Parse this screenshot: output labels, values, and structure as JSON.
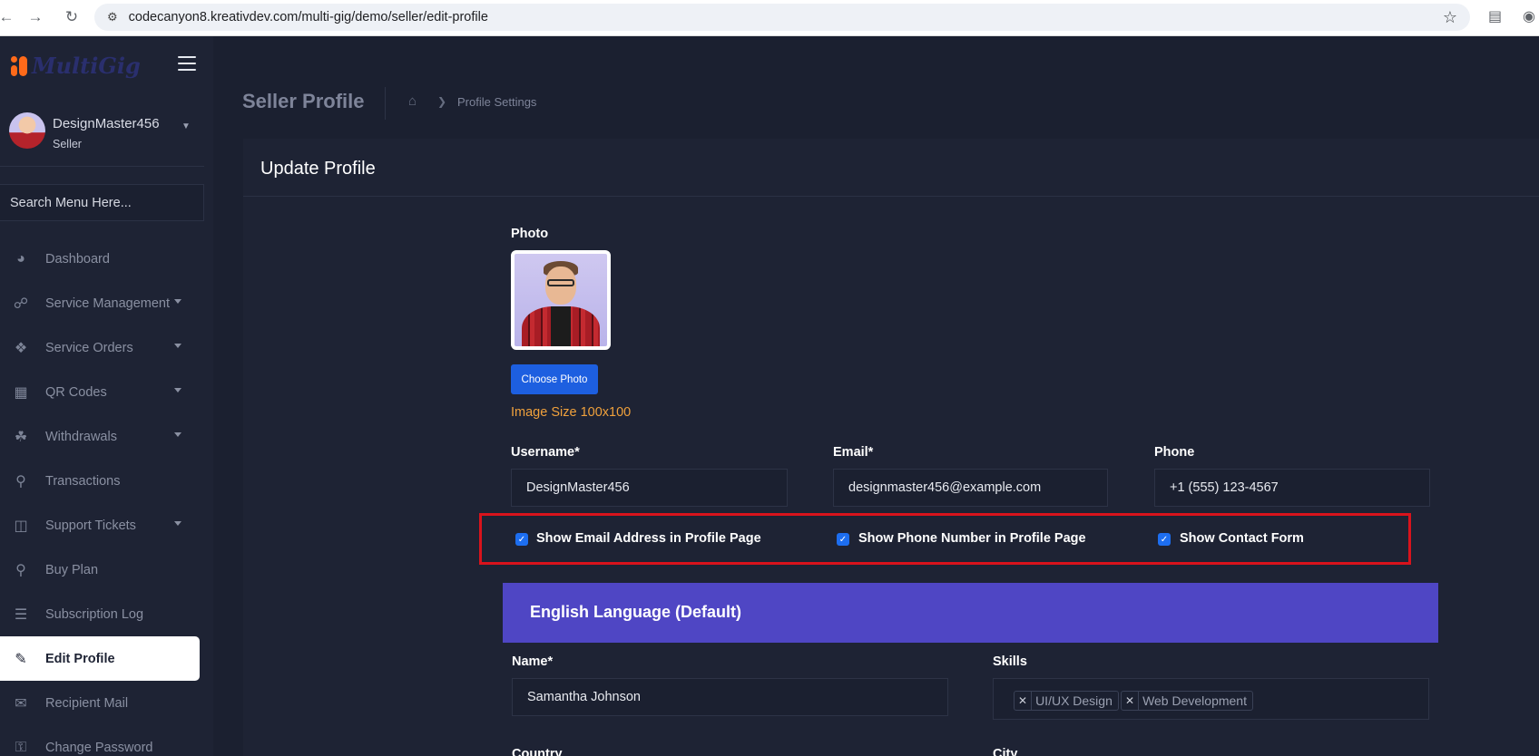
{
  "browser": {
    "url": "codecanyon8.kreativdev.com/multi-gig/demo/seller/edit-profile"
  },
  "brand": {
    "logo_text": "MultiGig",
    "accent": "#ff6a1a"
  },
  "user": {
    "name": "DesignMaster456",
    "role": "Seller"
  },
  "sidebar": {
    "search_placeholder": "Search Menu Here...",
    "items": [
      {
        "label": "Dashboard",
        "icon": "gauge-icon",
        "caret": false
      },
      {
        "label": "Service Management",
        "icon": "headset-icon",
        "caret": true
      },
      {
        "label": "Service Orders",
        "icon": "boxes-icon",
        "caret": true
      },
      {
        "label": "QR Codes",
        "icon": "qr-code-icon",
        "caret": true
      },
      {
        "label": "Withdrawals",
        "icon": "money-bag-icon",
        "caret": true
      },
      {
        "label": "Transactions",
        "icon": "lightbulb-icon",
        "caret": false
      },
      {
        "label": "Support Tickets",
        "icon": "ticket-icon",
        "caret": true
      },
      {
        "label": "Buy Plan",
        "icon": "bulb-icon",
        "caret": false
      },
      {
        "label": "Subscription Log",
        "icon": "list-icon",
        "caret": false
      },
      {
        "label": "Edit Profile",
        "icon": "user-edit-icon",
        "caret": false,
        "active": true
      },
      {
        "label": "Recipient Mail",
        "icon": "envelope-icon",
        "caret": false
      },
      {
        "label": "Change Password",
        "icon": "key-icon",
        "caret": false
      }
    ]
  },
  "header": {
    "page_title": "Seller Profile",
    "breadcrumb_current": "Profile Settings"
  },
  "card": {
    "title": "Update Profile",
    "photo_label": "Photo",
    "choose_photo": "Choose Photo",
    "image_size_note": "Image Size 100x100",
    "username_label": "Username*",
    "username_value": "DesignMaster456",
    "email_label": "Email*",
    "email_value": "designmaster456@example.com",
    "phone_label": "Phone",
    "phone_value": "+1 (555) 123-4567",
    "checkboxes": [
      {
        "label": "Show Email Address in Profile Page",
        "checked": true
      },
      {
        "label": "Show Phone Number in Profile Page",
        "checked": true
      },
      {
        "label": "Show Contact Form",
        "checked": true
      }
    ],
    "language_title": "English Language (Default)",
    "name_label": "Name*",
    "name_value": "Samantha Johnson",
    "skills_label": "Skills",
    "skills": [
      "UI/UX Design",
      "Web Development"
    ],
    "country_label": "Country",
    "city_label": "City"
  },
  "colors": {
    "highlight_border": "#d9131c",
    "primary_button": "#1d5fe0",
    "language_bar": "#4f46c4",
    "note_orange": "#f0a13c"
  }
}
